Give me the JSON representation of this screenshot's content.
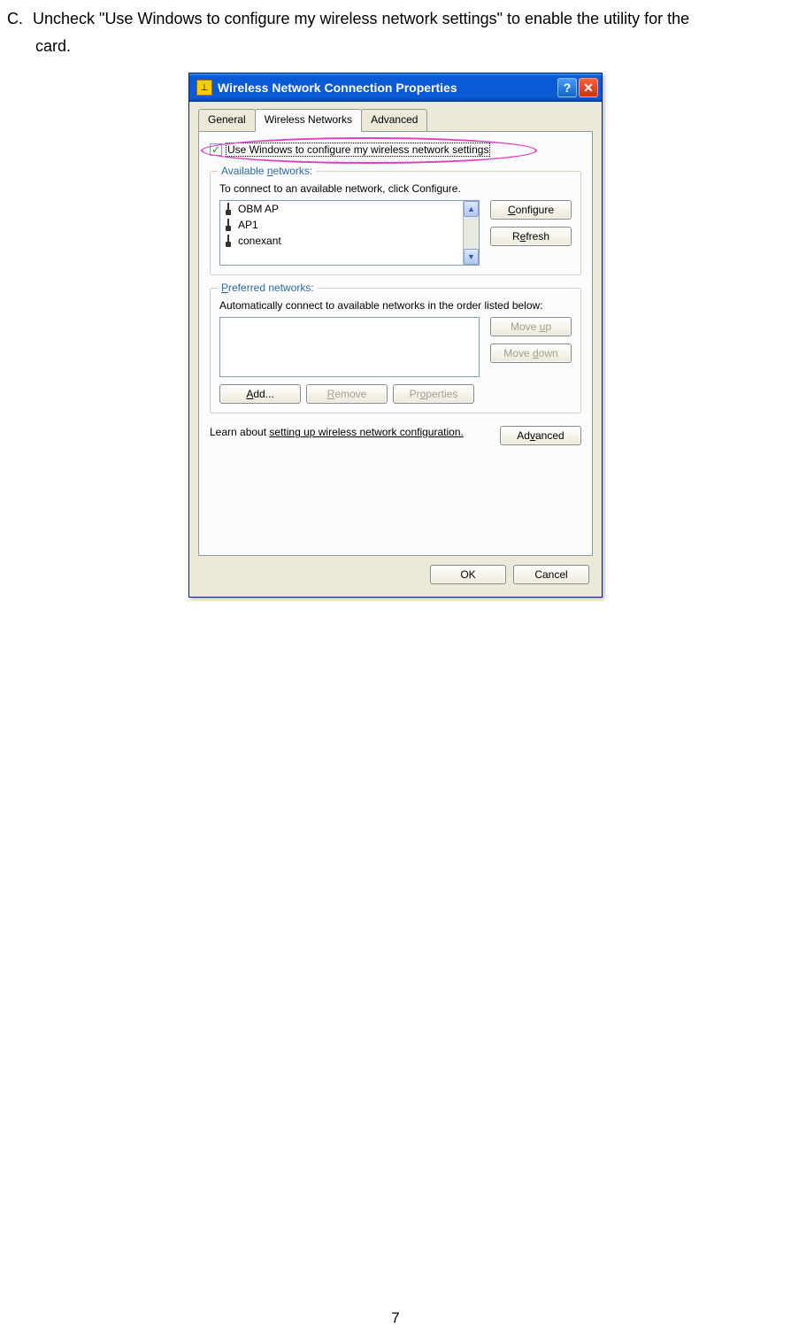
{
  "instruction": {
    "label": "C.",
    "text_line1": "Uncheck \"Use Windows to configure my wireless network settings\" to enable the utility for the",
    "text_line2": "card."
  },
  "dialog": {
    "title": "Wireless Network Connection Properties",
    "tabs": [
      {
        "label": "General",
        "active": false
      },
      {
        "label": "Wireless Networks",
        "active": true
      },
      {
        "label": "Advanced",
        "active": false
      }
    ],
    "checkbox_label": "Use Windows to configure my wireless network settings",
    "available": {
      "legend": "Available networks:",
      "desc": "To connect to an available network, click Configure.",
      "items": [
        "OBM AP",
        "AP1",
        "conexant"
      ],
      "configure": "Configure",
      "refresh": "Refresh"
    },
    "preferred": {
      "legend": "Preferred networks:",
      "desc": "Automatically connect to available networks in the order listed below:",
      "move_up": "Move up",
      "move_down": "Move down",
      "add": "Add...",
      "remove": "Remove",
      "properties": "Properties"
    },
    "learn": {
      "prefix": "Learn about ",
      "link": "setting up wireless network configuration."
    },
    "advanced_btn": "Advanced",
    "ok": "OK",
    "cancel": "Cancel"
  },
  "page_number": "7"
}
